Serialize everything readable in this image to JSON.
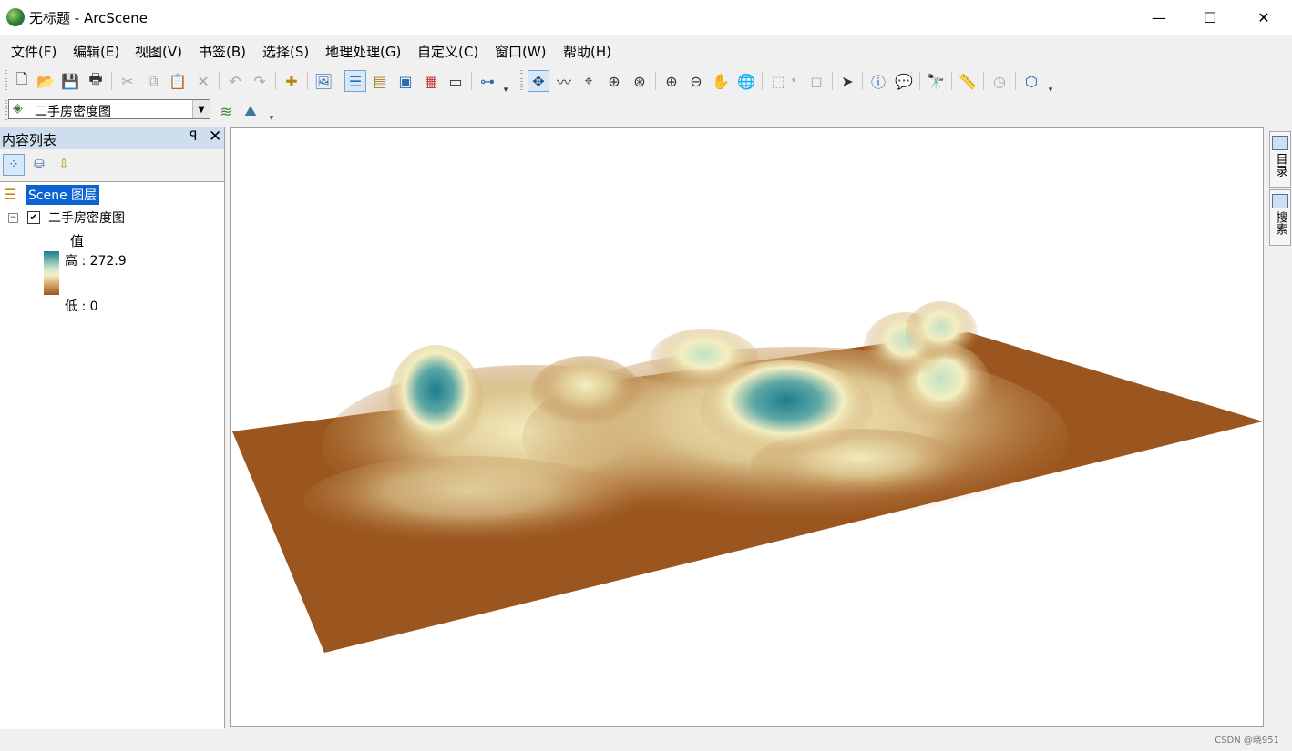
{
  "window": {
    "title": "无标题 - ArcScene",
    "minimize": "—",
    "maximize": "☐",
    "close": "✕"
  },
  "menu": [
    "文件(F)",
    "编辑(E)",
    "视图(V)",
    "书签(B)",
    "选择(S)",
    "地理处理(G)",
    "自定义(C)",
    "窗口(W)",
    "帮助(H)"
  ],
  "layer_selector": {
    "value": "二手房密度图",
    "arrow": "▼"
  },
  "toc": {
    "title": "内容列表",
    "pin": "ꟼ",
    "close": "✕",
    "root_label": "Scene 图层",
    "layer": {
      "name": "二手房密度图",
      "checked": "✔",
      "expander": "−"
    },
    "legend": {
      "field": "值",
      "high": "高 : 272.9",
      "low": "低 : 0"
    }
  },
  "dock_tabs": [
    "目录",
    "搜索"
  ],
  "status": {
    "watermark": "CSDN @晓951"
  },
  "colors": {
    "peak": "#1c7d8d",
    "mid": "#f4eec0",
    "base": "#9b561f",
    "selection": "#0a64d2"
  }
}
